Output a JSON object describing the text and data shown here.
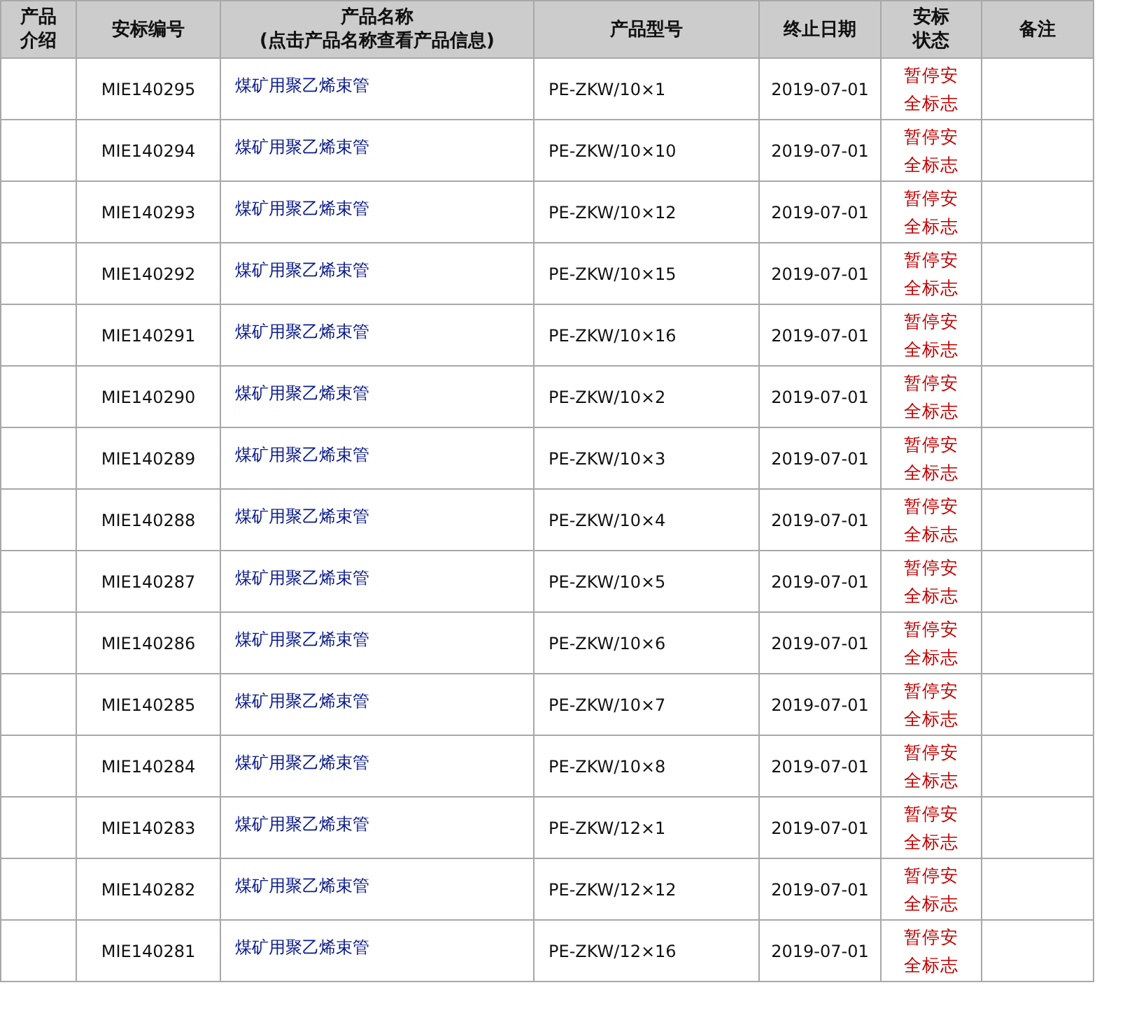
{
  "table": {
    "columns": [
      "产品介绍",
      "安标编号",
      "产品名称\n(点击产品名称查看产品信息)",
      "产品型号",
      "终止日期",
      "安标状态",
      "备注"
    ],
    "rows": [
      {
        "code": "MIE140295",
        "name": "煤矿用聚乙烯束管",
        "model": "PE-ZKW/10×1",
        "date": "2019-07-01",
        "status": "暂停安全标志"
      },
      {
        "code": "MIE140294",
        "name": "煤矿用聚乙烯束管",
        "model": "PE-ZKW/10×10",
        "date": "2019-07-01",
        "status": "暂停安全标志"
      },
      {
        "code": "MIE140293",
        "name": "煤矿用聚乙烯束管",
        "model": "PE-ZKW/10×12",
        "date": "2019-07-01",
        "status": "暂停安全标志"
      },
      {
        "code": "MIE140292",
        "name": "煤矿用聚乙烯束管",
        "model": "PE-ZKW/10×15",
        "date": "2019-07-01",
        "status": "暂停安全标志"
      },
      {
        "code": "MIE140291",
        "name": "煤矿用聚乙烯束管",
        "model": "PE-ZKW/10×16",
        "date": "2019-07-01",
        "status": "暂停安全标志"
      },
      {
        "code": "MIE140290",
        "name": "煤矿用聚乙烯束管",
        "model": "PE-ZKW/10×2",
        "date": "2019-07-01",
        "status": "暂停安全标志"
      },
      {
        "code": "MIE140289",
        "name": "煤矿用聚乙烯束管",
        "model": "PE-ZKW/10×3",
        "date": "2019-07-01",
        "status": "暂停安全标志"
      },
      {
        "code": "MIE140288",
        "name": "煤矿用聚乙烯束管",
        "model": "PE-ZKW/10×4",
        "date": "2019-07-01",
        "status": "暂停安全标志"
      },
      {
        "code": "MIE140287",
        "name": "煤矿用聚乙烯束管",
        "model": "PE-ZKW/10×5",
        "date": "2019-07-01",
        "status": "暂停安全标志"
      },
      {
        "code": "MIE140286",
        "name": "煤矿用聚乙烯束管",
        "model": "PE-ZKW/10×6",
        "date": "2019-07-01",
        "status": "暂停安全标志"
      },
      {
        "code": "MIE140285",
        "name": "煤矿用聚乙烯束管",
        "model": "PE-ZKW/10×7",
        "date": "2019-07-01",
        "status": "暂停安全标志"
      },
      {
        "code": "MIE140284",
        "name": "煤矿用聚乙烯束管",
        "model": "PE-ZKW/10×8",
        "date": "2019-07-01",
        "status": "暂停安全标志"
      },
      {
        "code": "MIE140283",
        "name": "煤矿用聚乙烯束管",
        "model": "PE-ZKW/12×1",
        "date": "2019-07-01",
        "status": "暂停安全标志"
      },
      {
        "code": "MIE140282",
        "name": "煤矿用聚乙烯束管",
        "model": "PE-ZKW/12×12",
        "date": "2019-07-01",
        "status": "暂停安全标志"
      },
      {
        "code": "MIE140281",
        "name": "煤矿用聚乙烯束管",
        "model": "PE-ZKW/12×16",
        "date": "2019-07-01",
        "status": "暂停安全标志"
      }
    ]
  }
}
